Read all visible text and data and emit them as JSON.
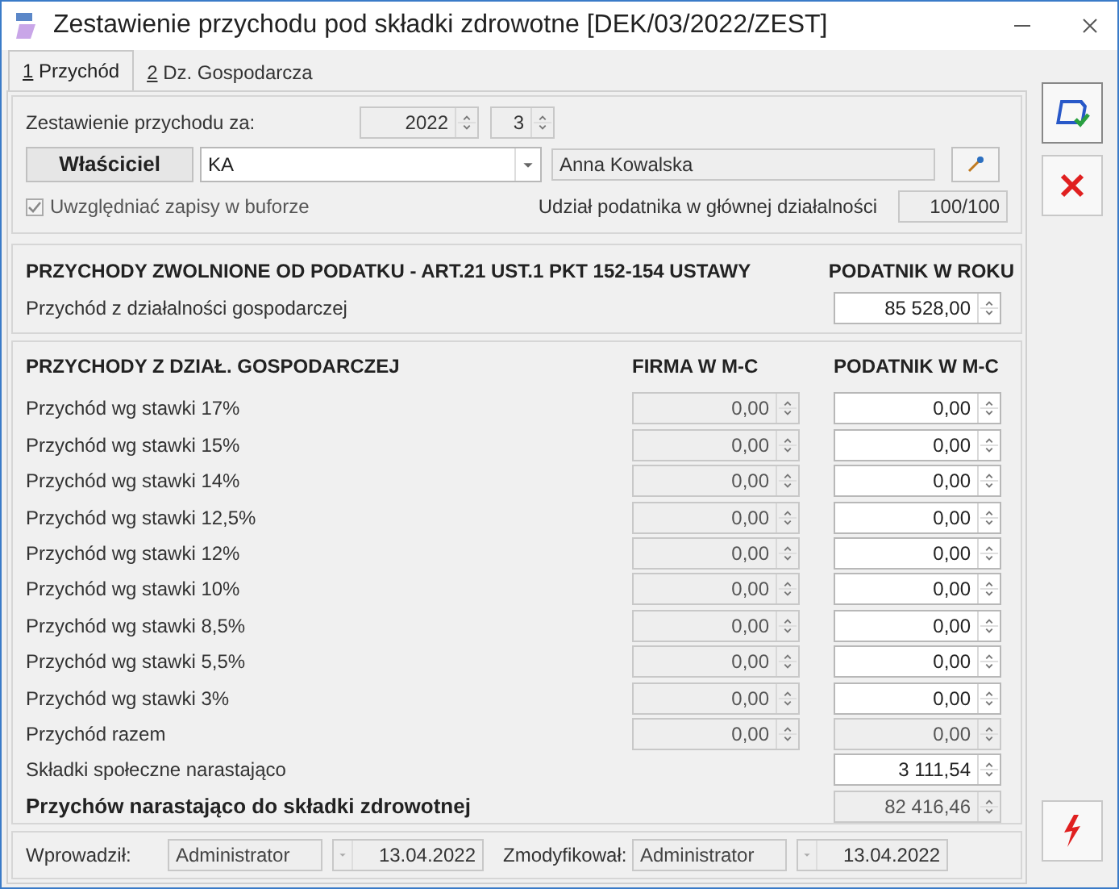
{
  "window": {
    "title": "Zestawienie przychodu pod składki zdrowotne [DEK/03/2022/ZEST]"
  },
  "tabs": [
    {
      "key": "1",
      "label": "Przychód",
      "selected": true
    },
    {
      "key": "2",
      "label": "Dz. Gospodarcza",
      "selected": false
    }
  ],
  "period": {
    "label": "Zestawienie przychodu za:",
    "year": "2022",
    "month": "3"
  },
  "owner": {
    "button": "Właściciel",
    "code": "KA",
    "name": "Anna Kowalska"
  },
  "buffer": {
    "label": "Uwzględniać zapisy w buforze",
    "checked": true
  },
  "share": {
    "label": "Udział podatnika w głównej działalności",
    "value": "100/100"
  },
  "exempt": {
    "heading": "PRZYCHODY ZWOLNIONE OD PODATKU - ART.21 UST.1 PKT 152-154 USTAWY",
    "column": "PODATNIK W ROKU",
    "rows": [
      {
        "label": "Przychód z działalności gospodarczej",
        "value": "85 528,00",
        "disabled": false
      }
    ]
  },
  "income": {
    "heading": "PRZYCHODY Z DZIAŁ. GOSPODARCZEJ",
    "columns": [
      "FIRMA W M-C",
      "PODATNIK W M-C"
    ],
    "rows": [
      {
        "kind": "rate",
        "label": "Przychód wg stawki 17%",
        "firma": {
          "value": "0,00",
          "disabled": true
        },
        "podatnik": {
          "value": "0,00",
          "disabled": false
        }
      },
      {
        "kind": "rate",
        "label": "Przychód wg stawki 15%",
        "firma": {
          "value": "0,00",
          "disabled": true
        },
        "podatnik": {
          "value": "0,00",
          "disabled": false
        }
      },
      {
        "kind": "rate",
        "label": "Przychód wg stawki 14%",
        "firma": {
          "value": "0,00",
          "disabled": true
        },
        "podatnik": {
          "value": "0,00",
          "disabled": false
        }
      },
      {
        "kind": "rate",
        "label": "Przychód wg stawki 12,5%",
        "firma": {
          "value": "0,00",
          "disabled": true
        },
        "podatnik": {
          "value": "0,00",
          "disabled": false
        }
      },
      {
        "kind": "rate",
        "label": "Przychód wg stawki 12%",
        "firma": {
          "value": "0,00",
          "disabled": true
        },
        "podatnik": {
          "value": "0,00",
          "disabled": false
        }
      },
      {
        "kind": "rate",
        "label": "Przychód wg stawki 10%",
        "firma": {
          "value": "0,00",
          "disabled": true
        },
        "podatnik": {
          "value": "0,00",
          "disabled": false
        }
      },
      {
        "kind": "rate",
        "label": "Przychód wg stawki 8,5%",
        "firma": {
          "value": "0,00",
          "disabled": true
        },
        "podatnik": {
          "value": "0,00",
          "disabled": false
        }
      },
      {
        "kind": "rate",
        "label": "Przychód wg stawki 5,5%",
        "firma": {
          "value": "0,00",
          "disabled": true
        },
        "podatnik": {
          "value": "0,00",
          "disabled": false
        }
      },
      {
        "kind": "rate",
        "label": "Przychód wg stawki 3%",
        "firma": {
          "value": "0,00",
          "disabled": true
        },
        "podatnik": {
          "value": "0,00",
          "disabled": false
        }
      },
      {
        "kind": "rate",
        "label": "Przychód razem",
        "firma": {
          "value": "0,00",
          "disabled": true
        },
        "podatnik": {
          "value": "0,00",
          "disabled": true
        }
      },
      {
        "kind": "single",
        "label": "Składki społeczne narastająco",
        "podatnik": {
          "value": "3 111,54",
          "disabled": false
        }
      },
      {
        "kind": "total",
        "label": "Przychów narastająco do składki zdrowotnej",
        "podatnik": {
          "value": "82 416,46",
          "disabled": true
        }
      }
    ]
  },
  "footer": {
    "entered_label": "Wprowadził:",
    "entered_by": "Administrator",
    "entered_date": "13.04.2022",
    "modified_label": "Zmodyfikował:",
    "modified_by": "Administrator",
    "modified_date": "13.04.2022"
  }
}
